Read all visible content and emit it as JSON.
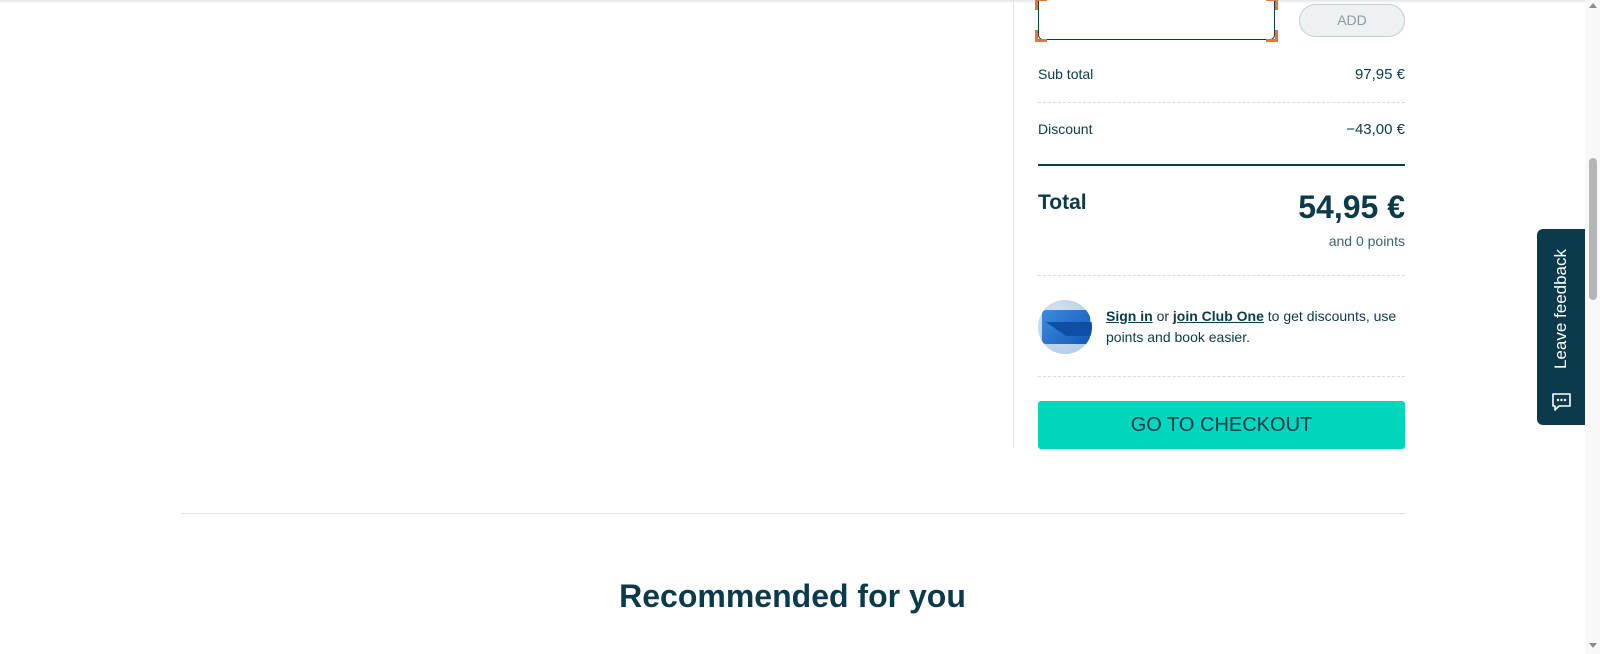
{
  "voucher": {
    "input_value": "",
    "add_label": "ADD"
  },
  "summary": {
    "subtotal_label": "Sub total",
    "subtotal_value": "97,95 €",
    "discount_label": "Discount",
    "discount_value": "−43,00 €",
    "total_label": "Total",
    "total_value": "54,95 €",
    "points_text": "and 0 points"
  },
  "club": {
    "sign_in": "Sign in",
    "or": "or",
    "join": "join Club One",
    "rest": "to get discounts, use points and book easier."
  },
  "checkout": {
    "label": "GO TO CHECKOUT"
  },
  "recommended": {
    "title": "Recommended for you"
  },
  "feedback": {
    "label": "Leave feedback"
  },
  "colors": {
    "primary": "#0b3a4a",
    "accent": "#00d6be",
    "focus": "#e8743b"
  }
}
